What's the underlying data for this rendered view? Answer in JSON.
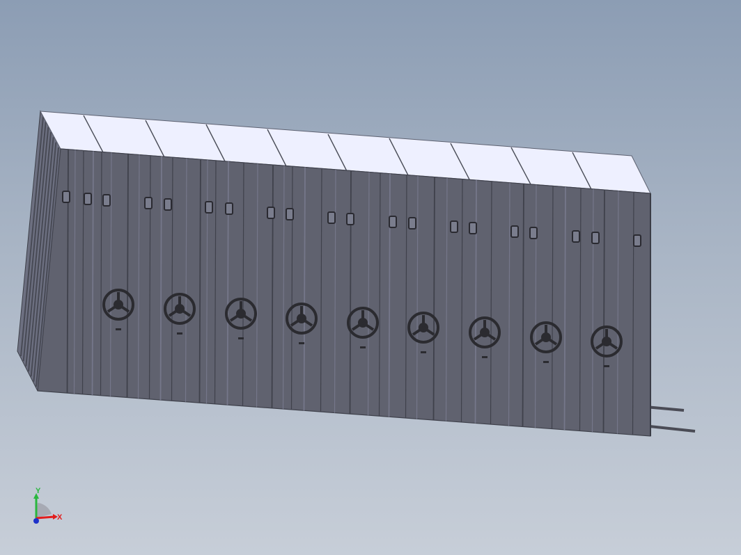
{
  "viewport": {
    "background_top": "#8c9db4",
    "background_bottom": "#c7ced8"
  },
  "model": {
    "name": "mobile-shelving-assembly",
    "cabinet_count": 9,
    "handwheel_count": 9,
    "colors": {
      "front": "#60626f",
      "seam": "#3f414b",
      "edge": "#75778a",
      "top": "#eef0ff",
      "handle": "#2a2a31",
      "wheel": "#2b2b30",
      "rail": "#4a4b55"
    }
  },
  "triad": {
    "x_label": "X",
    "y_label": "Y",
    "x_color": "#e21d1d",
    "y_color": "#29b73e",
    "z_color": "#1d31c9"
  }
}
